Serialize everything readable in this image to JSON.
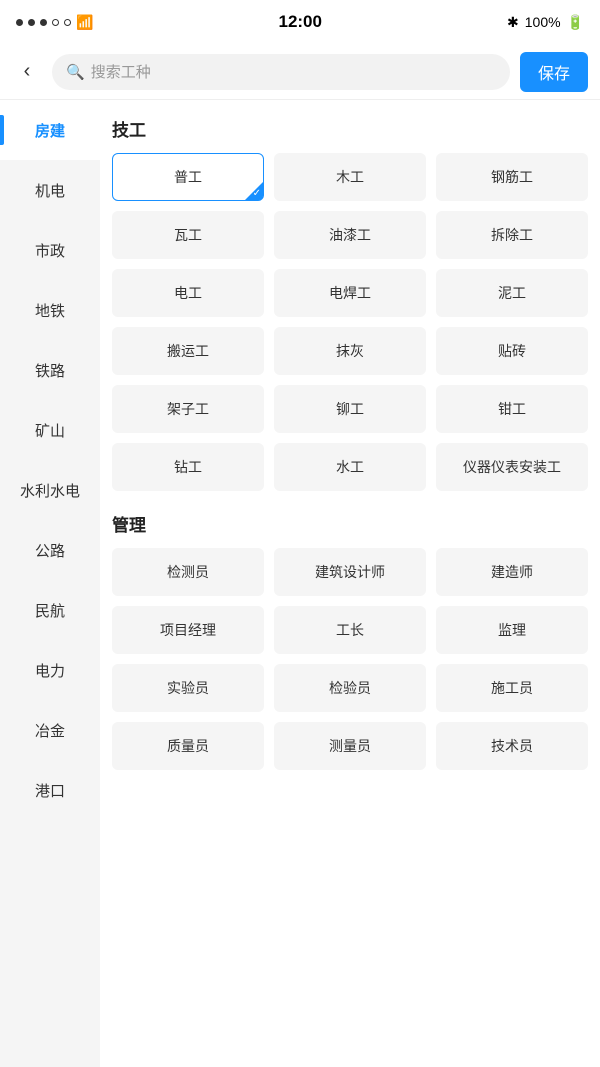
{
  "statusBar": {
    "time": "12:00",
    "battery": "100%",
    "batteryIcon": "🔋"
  },
  "header": {
    "backLabel": "‹",
    "searchPlaceholder": "搜索工种",
    "saveLabel": "保存"
  },
  "sidebar": {
    "items": [
      {
        "id": "fang-jian",
        "label": "房建",
        "active": true
      },
      {
        "id": "ji-dian",
        "label": "机电",
        "active": false
      },
      {
        "id": "shi-zheng",
        "label": "市政",
        "active": false
      },
      {
        "id": "di-tie",
        "label": "地铁",
        "active": false
      },
      {
        "id": "tie-lu",
        "label": "铁路",
        "active": false
      },
      {
        "id": "kuang-shan",
        "label": "矿山",
        "active": false
      },
      {
        "id": "shui-li",
        "label": "水利水电",
        "active": false
      },
      {
        "id": "gong-lu",
        "label": "公路",
        "active": false
      },
      {
        "id": "min-hang",
        "label": "民航",
        "active": false
      },
      {
        "id": "dian-li",
        "label": "电力",
        "active": false
      },
      {
        "id": "ye-jin",
        "label": "冶金",
        "active": false
      },
      {
        "id": "gang-kou",
        "label": "港口",
        "active": false
      }
    ]
  },
  "rightPanel": {
    "sections": [
      {
        "id": "ji-gong",
        "title": "技工",
        "items": [
          {
            "id": "pu-gong",
            "label": "普工",
            "selected": true
          },
          {
            "id": "mu-gong",
            "label": "木工",
            "selected": false
          },
          {
            "id": "gang-jin-gong",
            "label": "钢筋工",
            "selected": false
          },
          {
            "id": "wa-gong",
            "label": "瓦工",
            "selected": false
          },
          {
            "id": "you-qi-gong",
            "label": "油漆工",
            "selected": false
          },
          {
            "id": "chai-chu-gong",
            "label": "拆除工",
            "selected": false
          },
          {
            "id": "dian-gong",
            "label": "电工",
            "selected": false
          },
          {
            "id": "dian-han-gong",
            "label": "电焊工",
            "selected": false
          },
          {
            "id": "ni-gong",
            "label": "泥工",
            "selected": false
          },
          {
            "id": "ban-yun-gong",
            "label": "搬运工",
            "selected": false
          },
          {
            "id": "mo-hui",
            "label": "抹灰",
            "selected": false
          },
          {
            "id": "tie-zhuan",
            "label": "贴砖",
            "selected": false
          },
          {
            "id": "jia-zi-gong",
            "label": "架子工",
            "selected": false
          },
          {
            "id": "liu-gong",
            "label": "铆工",
            "selected": false
          },
          {
            "id": "qian-gong",
            "label": "钳工",
            "selected": false
          },
          {
            "id": "zuan-gong",
            "label": "钻工",
            "selected": false
          },
          {
            "id": "shui-gong",
            "label": "水工",
            "selected": false
          },
          {
            "id": "yi-qi",
            "label": "仪器仪表安装工",
            "selected": false
          }
        ]
      },
      {
        "id": "guan-li",
        "title": "管理",
        "items": [
          {
            "id": "jian-ce-yuan",
            "label": "检测员",
            "selected": false
          },
          {
            "id": "jian-zhu-she-ji-shi",
            "label": "建筑设计师",
            "selected": false
          },
          {
            "id": "jian-zao-shi",
            "label": "建造师",
            "selected": false
          },
          {
            "id": "xiang-mu-jing-li",
            "label": "项目经理",
            "selected": false
          },
          {
            "id": "gong-zhang",
            "label": "工长",
            "selected": false
          },
          {
            "id": "jian-li",
            "label": "监理",
            "selected": false
          },
          {
            "id": "shi-yan-yuan",
            "label": "实验员",
            "selected": false
          },
          {
            "id": "jian-yan-yuan",
            "label": "检验员",
            "selected": false
          },
          {
            "id": "shi-gong-yuan",
            "label": "施工员",
            "selected": false
          },
          {
            "id": "zhi-liang-yuan",
            "label": "质量员",
            "selected": false
          },
          {
            "id": "ce-liang-yuan",
            "label": "测量员",
            "selected": false
          },
          {
            "id": "ji-shu-yuan",
            "label": "技术员",
            "selected": false
          }
        ]
      }
    ]
  }
}
